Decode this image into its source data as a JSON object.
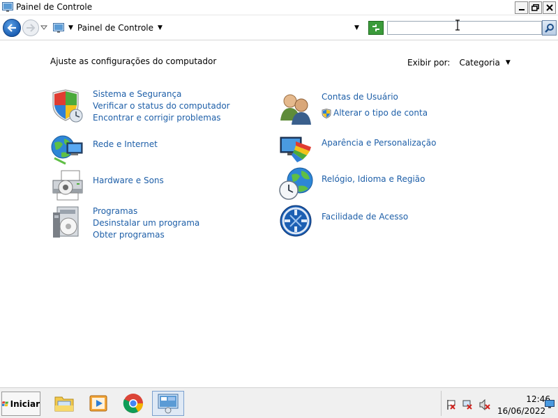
{
  "window": {
    "title": "Painel de Controle",
    "controls": {
      "minimize": "minimize",
      "maximize": "restore",
      "close": "close"
    }
  },
  "navbar": {
    "address_label": "Painel de Controle",
    "search_placeholder": ""
  },
  "content": {
    "heading": "Ajuste as configurações do computador",
    "view_by": {
      "label": "Exibir por:",
      "value": "Categoria"
    },
    "left_categories": [
      {
        "icon": "shield-icon",
        "title": "Sistema e Segurança",
        "links": [
          "Verificar o status do computador",
          "Encontrar e corrigir problemas"
        ]
      },
      {
        "icon": "network-globe-icon",
        "title": "Rede e Internet",
        "links": []
      },
      {
        "icon": "printer-icon",
        "title": "Hardware e Sons",
        "links": []
      },
      {
        "icon": "programs-icon",
        "title": "Programas",
        "links": [
          "Desinstalar um programa",
          "Obter programas"
        ]
      }
    ],
    "right_categories": [
      {
        "icon": "users-icon",
        "title": "Contas de Usuário",
        "links": [
          "Alterar o tipo de conta"
        ]
      },
      {
        "icon": "appearance-icon",
        "title": "Aparência e Personalização",
        "links": []
      },
      {
        "icon": "clock-globe-icon",
        "title": "Relógio, Idioma e Região",
        "links": []
      },
      {
        "icon": "ease-of-access-icon",
        "title": "Facilidade de Acesso",
        "links": []
      }
    ]
  },
  "taskbar": {
    "start_label": "Iniciar",
    "apps": [
      {
        "name": "file-explorer-icon"
      },
      {
        "name": "media-player-icon"
      },
      {
        "name": "chrome-icon"
      },
      {
        "name": "control-panel-icon",
        "active": true
      }
    ],
    "clock": {
      "time": "12:46",
      "date": "16/06/2022"
    }
  },
  "colors": {
    "link": "#1e5fa8",
    "accent": "#1c5fb3"
  }
}
